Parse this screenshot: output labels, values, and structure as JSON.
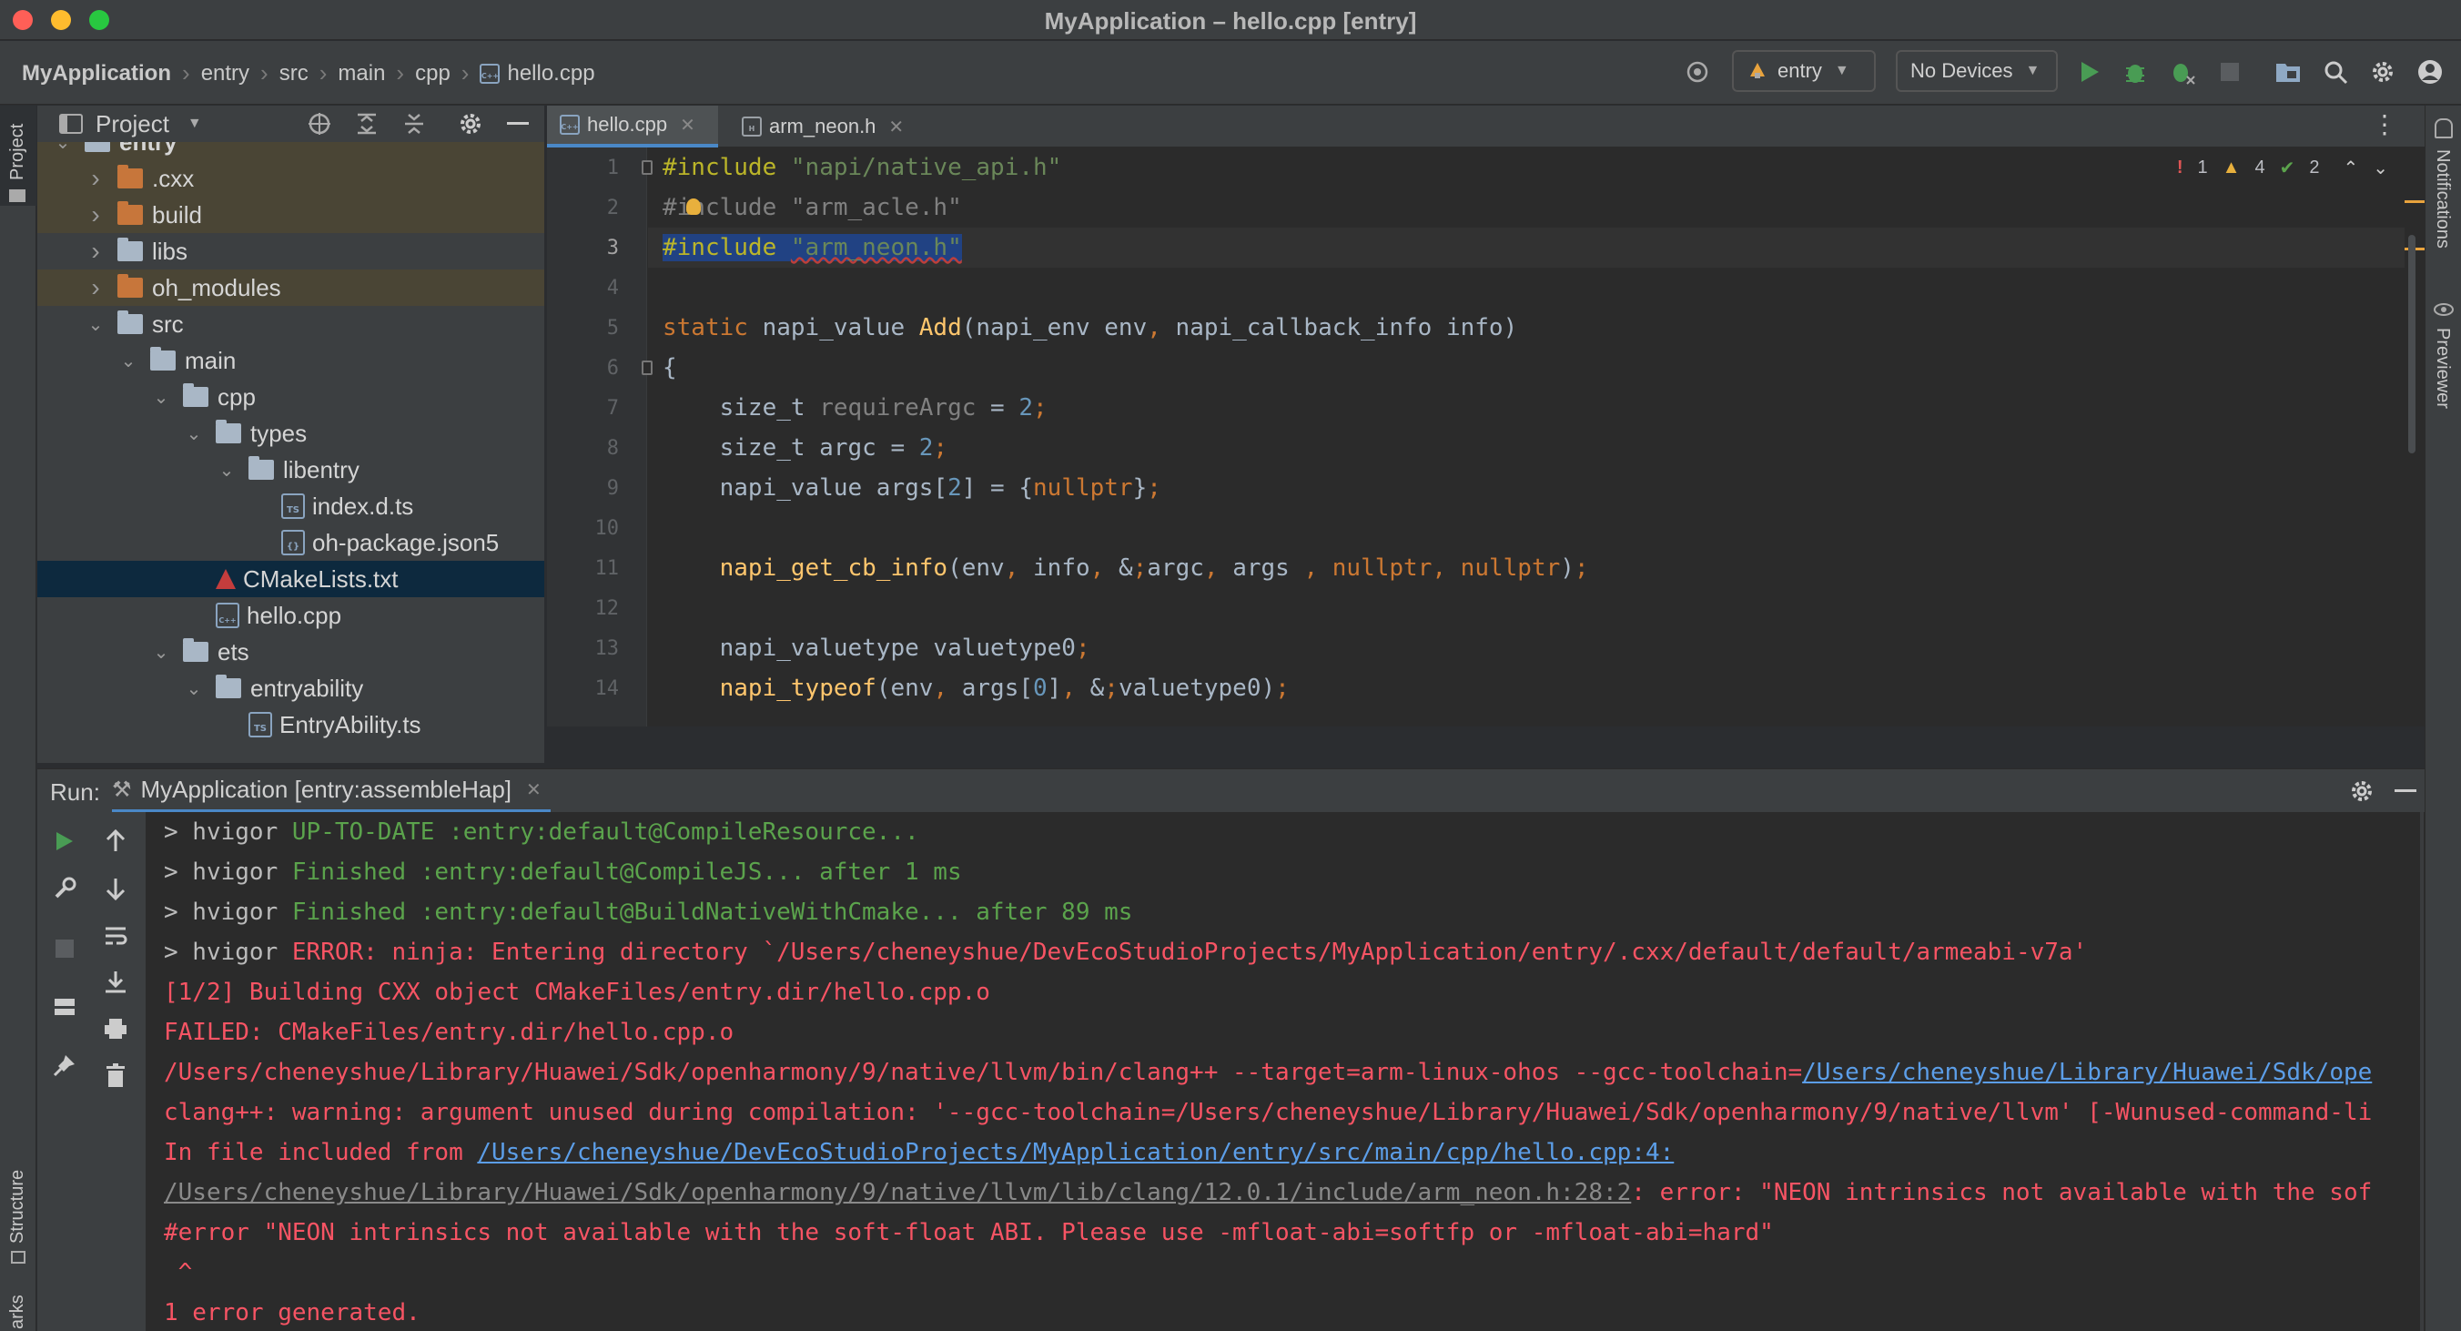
{
  "window": {
    "title": "MyApplication – hello.cpp [entry]"
  },
  "breadcrumb": [
    "MyApplication",
    "entry",
    "src",
    "main",
    "cpp",
    "hello.cpp"
  ],
  "toolbar": {
    "module_select": "entry",
    "device_select": "No Devices"
  },
  "side_tabs": {
    "project": "Project",
    "structure": "Structure",
    "bookmarks": "arks",
    "notifications": "Notifications",
    "previewer": "Previewer"
  },
  "project_panel": {
    "title": "Project",
    "tree": [
      {
        "label": "entry",
        "depth": 0,
        "type": "folder",
        "expanded": true
      },
      {
        "label": ".cxx",
        "depth": 1,
        "type": "folder-orange",
        "expanded": false
      },
      {
        "label": "build",
        "depth": 1,
        "type": "folder-orange",
        "expanded": false
      },
      {
        "label": "libs",
        "depth": 1,
        "type": "folder",
        "expanded": false
      },
      {
        "label": "oh_modules",
        "depth": 1,
        "type": "folder-orange",
        "expanded": false
      },
      {
        "label": "src",
        "depth": 1,
        "type": "folder",
        "expanded": true
      },
      {
        "label": "main",
        "depth": 2,
        "type": "folder",
        "expanded": true
      },
      {
        "label": "cpp",
        "depth": 3,
        "type": "folder",
        "expanded": true
      },
      {
        "label": "types",
        "depth": 4,
        "type": "folder",
        "expanded": true
      },
      {
        "label": "libentry",
        "depth": 5,
        "type": "folder",
        "expanded": true
      },
      {
        "label": "index.d.ts",
        "depth": 6,
        "type": "ts-file"
      },
      {
        "label": "oh-package.json5",
        "depth": 6,
        "type": "json-file"
      },
      {
        "label": "CMakeLists.txt",
        "depth": 4,
        "type": "cmake-file",
        "selected": true
      },
      {
        "label": "hello.cpp",
        "depth": 4,
        "type": "cpp-file"
      },
      {
        "label": "ets",
        "depth": 3,
        "type": "folder",
        "expanded": true
      },
      {
        "label": "entryability",
        "depth": 4,
        "type": "folder",
        "expanded": true
      },
      {
        "label": "EntryAbility.ts",
        "depth": 5,
        "type": "ts-file"
      }
    ]
  },
  "editor": {
    "tabs": [
      {
        "label": "hello.cpp",
        "active": true
      },
      {
        "label": "arm_neon.h",
        "active": false
      }
    ],
    "inspections": {
      "errors": "1",
      "warnings": "4",
      "ok": "2"
    },
    "line_numbers": [
      "1",
      "2",
      "3",
      "4",
      "5",
      "6",
      "7",
      "8",
      "9",
      "10",
      "11",
      "12",
      "13",
      "14"
    ],
    "lines": [
      "#include \"napi/native_api.h\"",
      "#include \"arm_acle.h\"",
      "#include \"arm_neon.h\"",
      "",
      "static napi_value Add(napi_env env, napi_callback_info info)",
      "{",
      "    size_t requireArgc = 2;",
      "    size_t argc = 2;",
      "    napi_value args[2] = {nullptr};",
      "",
      "    napi_get_cb_info(env, info, &argc, args , nullptr, nullptr);",
      "",
      "    napi_valuetype valuetype0;",
      "    napi_typeof(env, args[0], &valuetype0);"
    ]
  },
  "run_panel": {
    "label": "Run:",
    "tab": "MyApplication [entry:assembleHap]",
    "console": [
      {
        "parts": [
          [
            "white",
            "> hvigor "
          ],
          [
            "green",
            "UP-TO-DATE :entry:default@CompileResource..."
          ]
        ]
      },
      {
        "parts": [
          [
            "white",
            "> hvigor "
          ],
          [
            "green",
            "Finished :entry:default@CompileJS... after 1 ms"
          ]
        ]
      },
      {
        "parts": [
          [
            "white",
            "> hvigor "
          ],
          [
            "green",
            "Finished :entry:default@BuildNativeWithCmake... after 89 ms"
          ]
        ]
      },
      {
        "parts": [
          [
            "white",
            "> hvigor "
          ],
          [
            "red",
            "ERROR: ninja: Entering directory `/Users/cheneyshue/DevEcoStudioProjects/MyApplication/entry/.cxx/default/default/armeabi-v7a'"
          ]
        ]
      },
      {
        "parts": [
          [
            "red",
            "[1/2] Building CXX object CMakeFiles/entry.dir/hello.cpp.o"
          ]
        ]
      },
      {
        "parts": [
          [
            "red",
            "FAILED: CMakeFiles/entry.dir/hello.cpp.o"
          ]
        ]
      },
      {
        "parts": [
          [
            "red",
            "/Users/cheneyshue/Library/Huawei/Sdk/openharmony/9/native/llvm/bin/clang++ --target=arm-linux-ohos --gcc-toolchain="
          ],
          [
            "link",
            "/Users/cheneyshue/Library/Huawei/Sdk/ope"
          ]
        ]
      },
      {
        "parts": [
          [
            "red",
            "clang++: warning: argument unused during compilation: '--gcc-toolchain=/Users/cheneyshue/Library/Huawei/Sdk/openharmony/9/native/llvm' [-Wunused-command-li"
          ]
        ]
      },
      {
        "parts": [
          [
            "red",
            "In file included from "
          ],
          [
            "link",
            "/Users/cheneyshue/DevEcoStudioProjects/MyApplication/entry/src/main/cpp/hello.cpp:4:"
          ]
        ]
      },
      {
        "parts": [
          [
            "dim",
            "/Users/cheneyshue/Library/Huawei/Sdk/openharmony/9/native/llvm/lib/clang/12.0.1/include/arm_neon.h:28:2"
          ],
          [
            "red",
            ": error: \"NEON intrinsics not available with the sof"
          ]
        ]
      },
      {
        "parts": [
          [
            "red",
            "#error \"NEON intrinsics not available with the soft-float ABI. Please use -mfloat-abi=softfp or -mfloat-abi=hard\""
          ]
        ]
      },
      {
        "parts": [
          [
            "red",
            " ^"
          ]
        ]
      },
      {
        "parts": [
          [
            "red",
            "1 error generated."
          ]
        ]
      }
    ]
  },
  "colors": {
    "accent": "#4a88c7",
    "error": "#f75464",
    "success": "#5ba34c",
    "link": "#5c9ee8"
  }
}
